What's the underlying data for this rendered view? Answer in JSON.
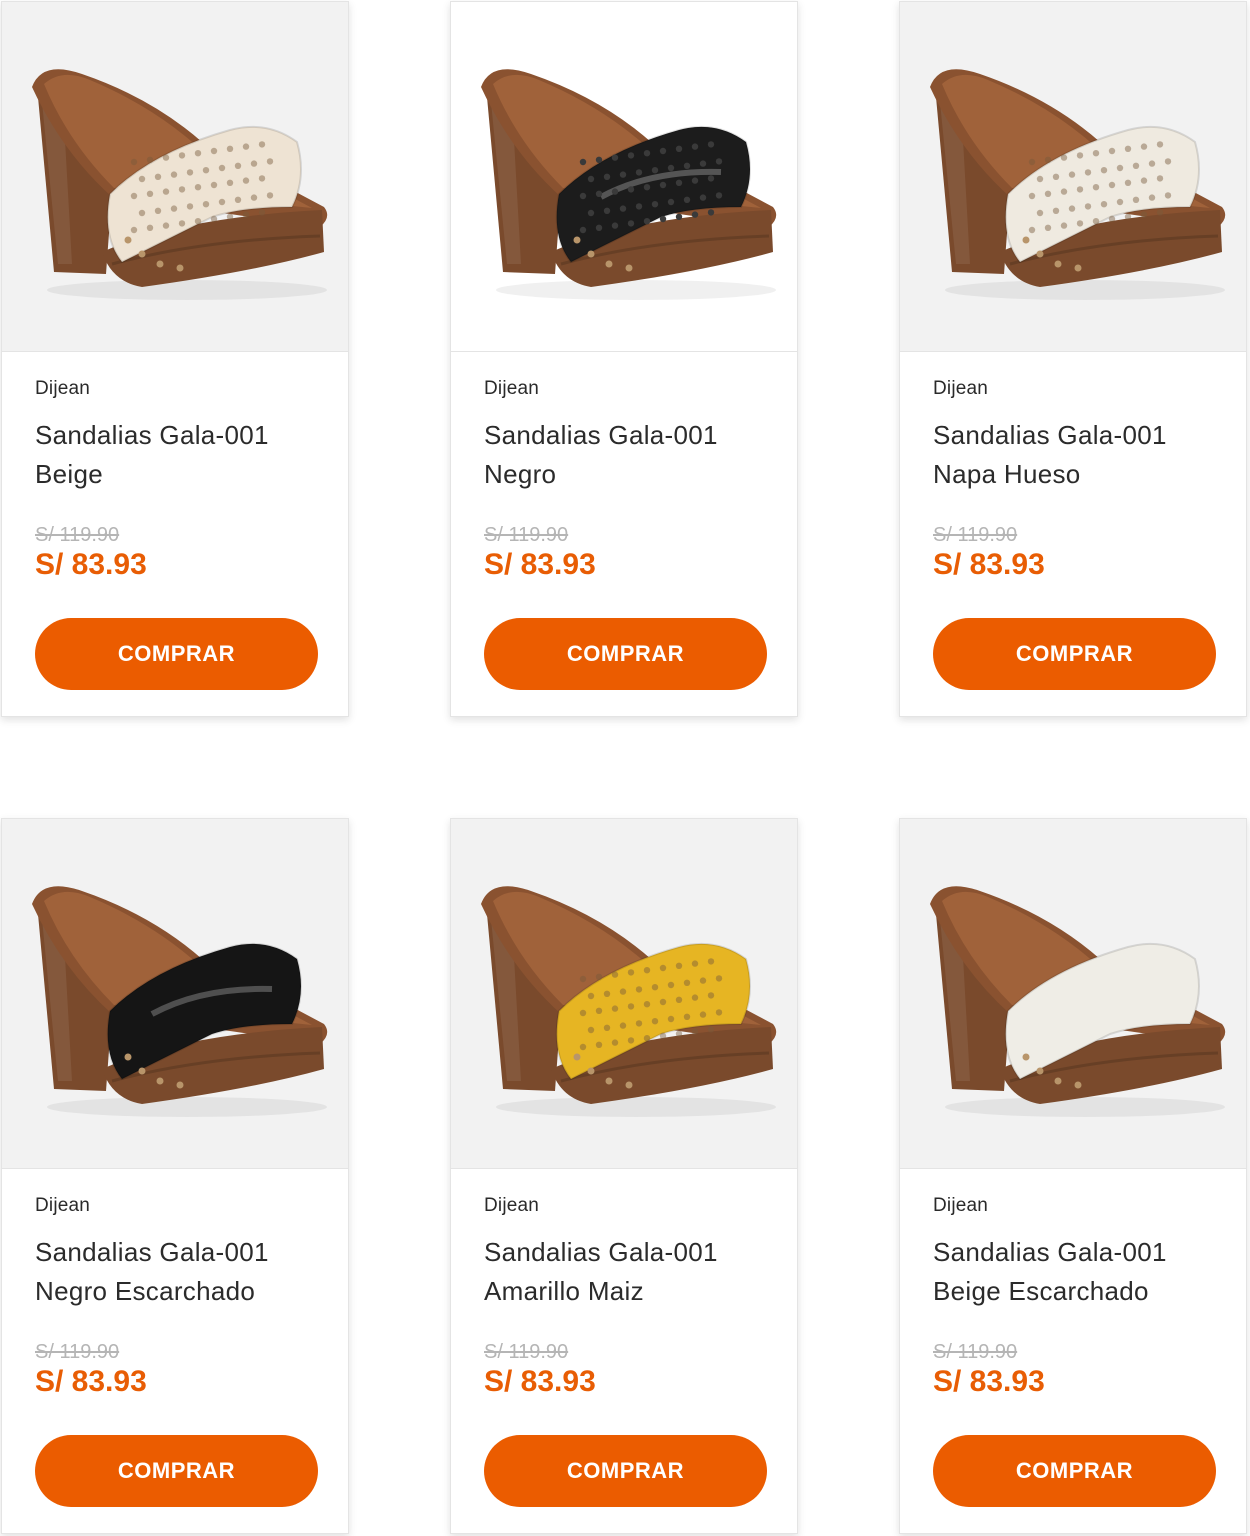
{
  "products": [
    {
      "brand": "Dijean",
      "name": "Sandalias Gala-001 Beige",
      "old_price": "S/ 119.90",
      "price": "S/ 83.93",
      "button": "COMPRAR",
      "strap_color": "#eee3d3",
      "perforated": true,
      "bg": "#f2f2f2"
    },
    {
      "brand": "Dijean",
      "name": "Sandalias Gala-001 Negro",
      "old_price": "S/ 119.90",
      "price": "S/ 83.93",
      "button": "COMPRAR",
      "strap_color": "#1c1c1c",
      "perforated": true,
      "bg": "#ffffff"
    },
    {
      "brand": "Dijean",
      "name": "Sandalias Gala-001 Napa Hueso",
      "old_price": "S/ 119.90",
      "price": "S/ 83.93",
      "button": "COMPRAR",
      "strap_color": "#efeae0",
      "perforated": true,
      "bg": "#f2f2f2"
    },
    {
      "brand": "Dijean",
      "name": "Sandalias Gala-001 Negro Escarchado",
      "old_price": "S/ 119.90",
      "price": "S/ 83.93",
      "button": "COMPRAR",
      "strap_color": "#151515",
      "perforated": false,
      "bg": "#f2f2f2"
    },
    {
      "brand": "Dijean",
      "name": "Sandalias Gala-001 Amarillo Maiz",
      "old_price": "S/ 119.90",
      "price": "S/ 83.93",
      "button": "COMPRAR",
      "strap_color": "#e6b523",
      "perforated": true,
      "bg": "#f2f2f2"
    },
    {
      "brand": "Dijean",
      "name": "Sandalias Gala-001 Beige Escarchado",
      "old_price": "S/ 119.90",
      "price": "S/ 83.93",
      "button": "COMPRAR",
      "strap_color": "#efede6",
      "perforated": false,
      "bg": "#f2f2f2"
    }
  ],
  "colors": {
    "accent": "#eb5c00",
    "price": "#e85d04",
    "old_price": "#b5b5b5",
    "wood": "#7a4a2c"
  }
}
